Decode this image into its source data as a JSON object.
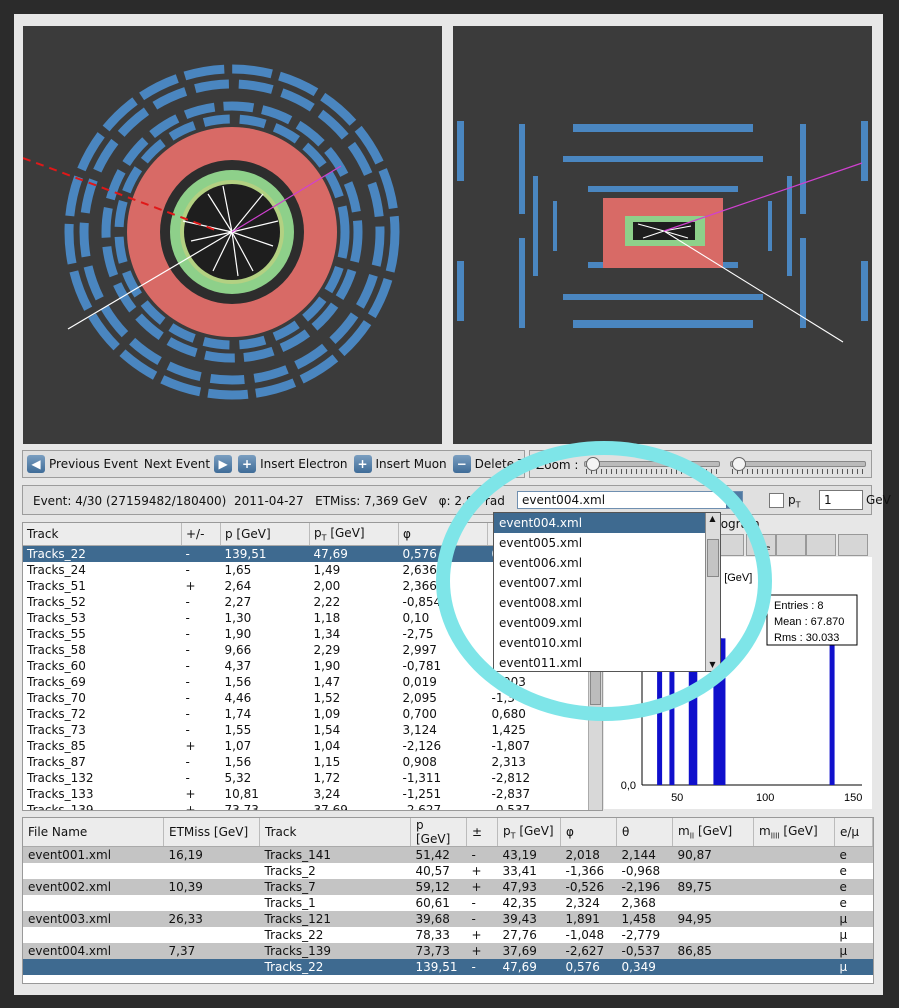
{
  "toolbar": {
    "prev": "Previous Event",
    "next": "Next Event",
    "insert_electron": "Insert Electron",
    "insert_muon": "Insert Muon",
    "delete_track": "Delete Track",
    "zoom_label": "Zoom :"
  },
  "info": {
    "event": "Event: 4/30 (27159482/180400)",
    "date": "2011-04-27",
    "etmiss": "ETMiss: 7,369 GeV",
    "phi": "φ: 2,80 rad",
    "file": "event004.xml",
    "pt_label": "pT",
    "pt_value": "1",
    "pt_unit": "GeV"
  },
  "dropdown": [
    "event004.xml",
    "event005.xml",
    "event006.xml",
    "event007.xml",
    "event008.xml",
    "event009.xml",
    "event010.xml",
    "event011.xml"
  ],
  "tracks": {
    "headers": [
      "Track",
      "+/-",
      "p [GeV]",
      "pT [GeV]",
      "φ",
      ""
    ],
    "rows": [
      [
        "Tracks_22",
        "-",
        "139,51",
        "47,69",
        "0,576",
        "0,349"
      ],
      [
        "Tracks_24",
        "-",
        "1,65",
        "1,49",
        "2,636",
        ""
      ],
      [
        "Tracks_51",
        "+",
        "2,64",
        "2,00",
        "2,366",
        ""
      ],
      [
        "Tracks_52",
        "-",
        "2,27",
        "2,22",
        "-0,854",
        ""
      ],
      [
        "Tracks_53",
        "-",
        "1,30",
        "1,18",
        "0,10",
        ""
      ],
      [
        "Tracks_55",
        "-",
        "1,90",
        "1,34",
        "-2,75",
        ""
      ],
      [
        "Tracks_58",
        "-",
        "9,66",
        "2,29",
        "2,997",
        ""
      ],
      [
        "Tracks_60",
        "-",
        "4,37",
        "1,90",
        "-0,781",
        ""
      ],
      [
        "Tracks_69",
        "-",
        "1,56",
        "1,47",
        "0,019",
        "1,903"
      ],
      [
        "Tracks_70",
        "-",
        "4,46",
        "1,52",
        "2,095",
        "-1,347"
      ],
      [
        "Tracks_72",
        "-",
        "1,74",
        "1,09",
        "0,700",
        "0,680"
      ],
      [
        "Tracks_73",
        "-",
        "1,55",
        "1,54",
        "3,124",
        "1,425"
      ],
      [
        "Tracks_85",
        "+",
        "1,07",
        "1,04",
        "-2,126",
        "-1,807"
      ],
      [
        "Tracks_87",
        "-",
        "1,56",
        "1,15",
        "0,908",
        "2,313"
      ],
      [
        "Tracks_132",
        "-",
        "5,32",
        "1,72",
        "-1,311",
        "-2,812"
      ],
      [
        "Tracks_133",
        "+",
        "10,81",
        "3,24",
        "-1,251",
        "-2,837"
      ],
      [
        "Tracks_139",
        "+",
        "73,73",
        "37,69",
        "-2,627",
        "-0,537"
      ]
    ]
  },
  "histogram": {
    "title": "togram",
    "tabs": [
      "m",
      "mee",
      "m",
      "m",
      "m"
    ],
    "ylabel": "P [GeV]",
    "stats": {
      "entries_label": "Entries :",
      "entries": "8",
      "mean_label": "Mean :",
      "mean": "67.870",
      "rms_label": "Rms :",
      "rms": "30.033"
    },
    "yticks": [
      "1,0",
      "0,5",
      "0,0"
    ],
    "xticks": [
      "50",
      "100",
      "150"
    ]
  },
  "chart_data": {
    "type": "bar",
    "x": [
      40,
      47,
      58,
      60,
      72,
      74,
      76,
      138
    ],
    "values": [
      1,
      1,
      1,
      1,
      1,
      1,
      1,
      1
    ],
    "xlim": [
      30,
      155
    ],
    "ylim": [
      0,
      1.5
    ],
    "color": "#1010cc"
  },
  "results": {
    "headers": [
      "File Name",
      "ETMiss [GeV]",
      "Track",
      "p [GeV]",
      "±",
      "pT [GeV]",
      "φ",
      "θ",
      "mll [GeV]",
      "mllll [GeV]",
      "e/μ"
    ],
    "rows": [
      [
        "event001.xml",
        "16,19",
        "Tracks_141",
        "51,42",
        "-",
        "43,19",
        "2,018",
        "2,144",
        "90,87",
        "",
        "e"
      ],
      [
        "",
        "",
        "Tracks_2",
        "40,57",
        "+",
        "33,41",
        "-1,366",
        "-0,968",
        "",
        "",
        "e"
      ],
      [
        "event002.xml",
        "10,39",
        "Tracks_7",
        "59,12",
        "+",
        "47,93",
        "-0,526",
        "-2,196",
        "89,75",
        "",
        "e"
      ],
      [
        "",
        "",
        "Tracks_1",
        "60,61",
        "-",
        "42,35",
        "2,324",
        "2,368",
        "",
        "",
        "e"
      ],
      [
        "event003.xml",
        "26,33",
        "Tracks_121",
        "39,68",
        "-",
        "39,43",
        "1,891",
        "1,458",
        "94,95",
        "",
        "μ"
      ],
      [
        "",
        "",
        "Tracks_22",
        "78,33",
        "+",
        "27,76",
        "-1,048",
        "-2,779",
        "",
        "",
        "μ"
      ],
      [
        "event004.xml",
        "7,37",
        "Tracks_139",
        "73,73",
        "+",
        "37,69",
        "-2,627",
        "-0,537",
        "86,85",
        "",
        "μ"
      ],
      [
        "",
        "",
        "Tracks_22",
        "139,51",
        "-",
        "47,69",
        "0,576",
        "0,349",
        "",
        "",
        "μ"
      ]
    ]
  },
  "colors": {
    "accent": "#3e6a90",
    "calo": "#d86a66",
    "muon": "#4a86c0",
    "highlight": "#7ee5e8"
  }
}
